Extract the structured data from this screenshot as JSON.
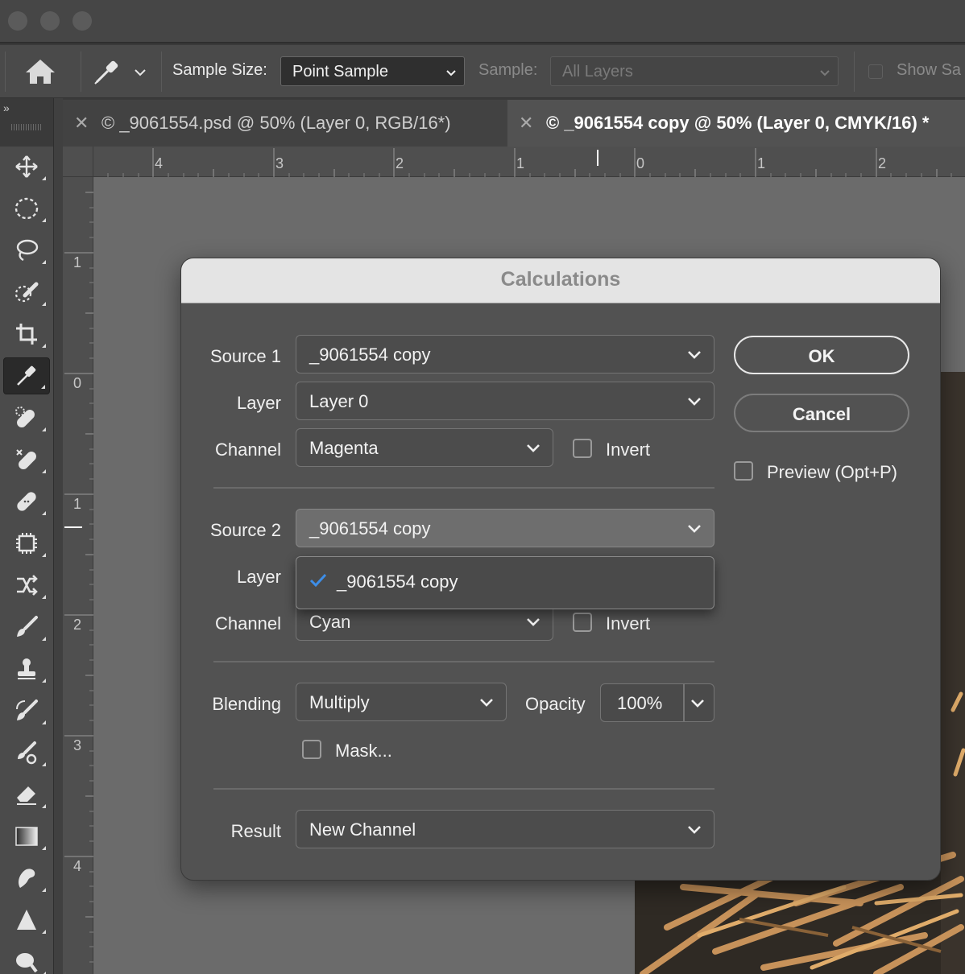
{
  "window": {
    "traffic_lights": [
      "close",
      "minimize",
      "zoom"
    ]
  },
  "options_bar": {
    "home_icon": "home-icon",
    "eyedropper_icon": "eyedropper-icon",
    "sample_size_label": "Sample Size:",
    "sample_size_value": "Point Sample",
    "sample_label": "Sample:",
    "sample_value": "All Layers",
    "show_sampling_label": "Show Sa"
  },
  "tabs": [
    {
      "label": "© _9061554.psd @ 50% (Layer 0, RGB/16*)",
      "active": false
    },
    {
      "label": "© _9061554 copy @ 50% (Layer 0, CMYK/16) *",
      "active": true
    }
  ],
  "panel_collapse_label": "»",
  "rulers": {
    "top": [
      "4",
      "3",
      "2",
      "1",
      "0",
      "1",
      "2"
    ],
    "left": [
      "1",
      "0",
      "1",
      "2",
      "3",
      "4"
    ]
  },
  "toolbar": [
    {
      "name": "move-tool",
      "icon": "move-icon"
    },
    {
      "name": "marquee-tool",
      "icon": "elliptical-marquee-icon"
    },
    {
      "name": "lasso-tool",
      "icon": "lasso-icon"
    },
    {
      "name": "quick-selection-tool",
      "icon": "quick-selection-icon"
    },
    {
      "name": "crop-tool",
      "icon": "crop-icon"
    },
    {
      "name": "eyedropper-tool",
      "icon": "eyedropper-icon",
      "active": true
    },
    {
      "name": "spot-healing-tool",
      "icon": "spot-healing-icon"
    },
    {
      "name": "healing-brush-tool",
      "icon": "healing-brush-icon"
    },
    {
      "name": "patch-tool",
      "icon": "bandage-icon"
    },
    {
      "name": "content-aware-tool",
      "icon": "content-aware-icon"
    },
    {
      "name": "content-aware-move-tool",
      "icon": "content-aware-move-icon"
    },
    {
      "name": "brush-tool",
      "icon": "brush-icon"
    },
    {
      "name": "clone-stamp-tool",
      "icon": "stamp-icon"
    },
    {
      "name": "history-brush-tool",
      "icon": "history-brush-icon"
    },
    {
      "name": "mixer-brush-tool",
      "icon": "mixer-brush-icon"
    },
    {
      "name": "eraser-tool",
      "icon": "eraser-icon"
    },
    {
      "name": "gradient-tool",
      "icon": "gradient-icon"
    },
    {
      "name": "smudge-tool",
      "icon": "smudge-icon"
    },
    {
      "name": "sharpen-tool",
      "icon": "sharpen-icon"
    },
    {
      "name": "dodge-tool",
      "icon": "dodge-icon"
    }
  ],
  "dialog": {
    "title": "Calculations",
    "source1": {
      "label": "Source 1",
      "value": "_9061554 copy",
      "layer_label": "Layer",
      "layer_value": "Layer 0",
      "channel_label": "Channel",
      "channel_value": "Magenta",
      "invert_label": "Invert",
      "invert_checked": false
    },
    "source2": {
      "label": "Source 2",
      "value": "_9061554 copy",
      "layer_label": "Layer",
      "layer_dropdown_item": "_9061554 copy",
      "channel_label": "Channel",
      "channel_value": "Cyan",
      "invert_label": "Invert",
      "invert_checked": false
    },
    "blending": {
      "label": "Blending",
      "value": "Multiply",
      "opacity_label": "Opacity",
      "opacity_value": "100%",
      "mask_label": "Mask...",
      "mask_checked": false
    },
    "result": {
      "label": "Result",
      "value": "New Channel"
    },
    "buttons": {
      "ok": "OK",
      "cancel": "Cancel"
    },
    "preview": {
      "label": "Preview (Opt+P)",
      "checked": false
    }
  },
  "colors": {
    "check_accent": "#3d8ee8",
    "dialog_bg": "#525252",
    "title_bar": "#e4e4e4"
  }
}
